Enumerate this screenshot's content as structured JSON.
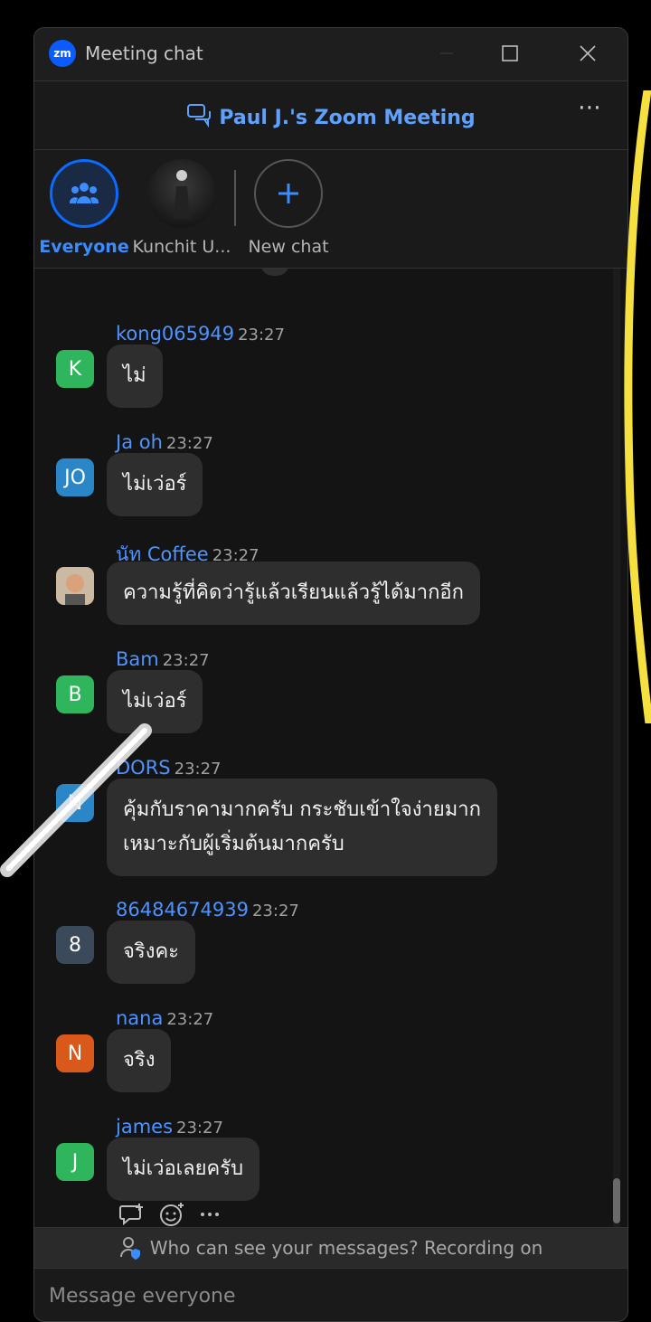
{
  "window": {
    "app_logo": "zm",
    "title": "Meeting chat",
    "controls": [
      "minimize-icon",
      "maximize-icon",
      "close-icon"
    ]
  },
  "header": {
    "meeting_title": "Paul J.'s Zoom Meeting",
    "icon": "chat-bubbles-icon",
    "more": "⋯"
  },
  "tabs": [
    {
      "label": "Everyone",
      "icon": "people-icon",
      "active": true
    },
    {
      "label": "Kunchit U...",
      "icon": "avatar-photo"
    },
    {
      "label": "New chat",
      "icon": "plus-icon"
    }
  ],
  "messages": [
    {
      "name": "kong065949",
      "time": "23:27",
      "avatar": "K",
      "avatar_color": "#2fb55c",
      "lines": [
        "ไม่"
      ]
    },
    {
      "name": "Ja oh",
      "time": "23:27",
      "avatar": "JO",
      "avatar_color": "#2a86c7",
      "lines": [
        "ไม่เว่อร์"
      ]
    },
    {
      "name": "นัท Coffee",
      "time": "23:27",
      "avatar": "",
      "avatar_color": "#8a7a6a",
      "lines": [
        "ความรู้ที่คิดว่ารู้แล้วเรียนแล้วรู้ได้มากอีก"
      ]
    },
    {
      "name": "Bam",
      "time": "23:27",
      "avatar": "B",
      "avatar_color": "#2fb55c",
      "lines": [
        "ไม่เว่อร์"
      ]
    },
    {
      "name": "DORS",
      "time": "23:27",
      "avatar": "N",
      "avatar_color": "#2a86c7",
      "lines": [
        "คุ้มกับราคามากครับ กระชับเข้าใจง่ายมาก",
        "เหมาะกับผู้เริ่มต้นมากครับ"
      ]
    },
    {
      "name": "86484674939",
      "time": "23:27",
      "avatar": "8",
      "avatar_color": "#3a4a5a",
      "lines": [
        "จริงคะ"
      ]
    },
    {
      "name": "nana",
      "time": "23:27",
      "avatar": "N",
      "avatar_color": "#d9591a",
      "lines": [
        "จริง"
      ]
    },
    {
      "name": "james",
      "time": "23:27",
      "avatar": "J",
      "avatar_color": "#2fb55c",
      "lines": [
        "ไม่เว่อเลยครับ"
      ]
    }
  ],
  "message_actions": [
    "reply-icon",
    "add-reaction-icon",
    "more-icon"
  ],
  "privacy": {
    "text": "Who can see your messages? Recording on",
    "icon": "person-shield-icon"
  },
  "composer": {
    "placeholder": "Message everyone"
  }
}
